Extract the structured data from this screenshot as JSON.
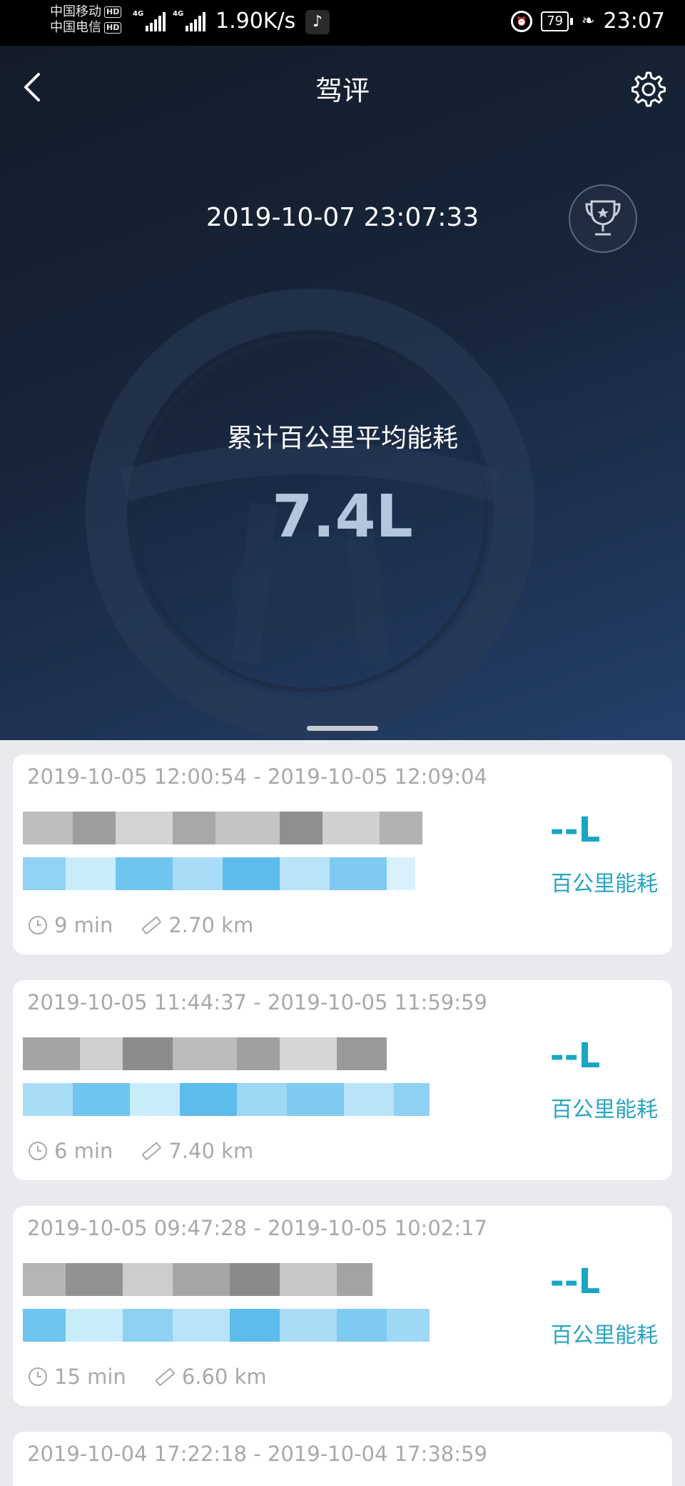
{
  "status_bar": {
    "carrier_1": "中国移动",
    "carrier_2": "中国电信",
    "hd_badge": "HD",
    "network_1": "4G",
    "network_2": "4G",
    "net_speed": "1.90K/s",
    "battery": "79",
    "time": "23:07"
  },
  "header": {
    "title": "驾评"
  },
  "summary": {
    "datetime": "2019-10-07 23:07:33",
    "avg_label": "累计百公里平均能耗",
    "avg_value": "7.4L"
  },
  "trips": [
    {
      "range": "2019-10-05 12:00:54 - 2019-10-05 12:09:04",
      "fuel": "--L",
      "fuel_label": "百公里能耗",
      "duration": "9 min",
      "distance": "2.70 km"
    },
    {
      "range": "2019-10-05 11:44:37 - 2019-10-05 11:59:59",
      "fuel": "--L",
      "fuel_label": "百公里能耗",
      "duration": "6 min",
      "distance": "7.40 km"
    },
    {
      "range": "2019-10-05 09:47:28 - 2019-10-05 10:02:17",
      "fuel": "--L",
      "fuel_label": "百公里能耗",
      "duration": "15 min",
      "distance": "6.60 km"
    },
    {
      "range": "2019-10-04 17:22:18 - 2019-10-04 17:38:59"
    }
  ],
  "colors": {
    "accent": "#1aa5c4",
    "hero_dark": "#141c29",
    "hero_light": "#24406a",
    "muted_text": "#a9a9ad"
  },
  "icons": {
    "back": "chevron-left-icon",
    "settings": "gear-icon",
    "trophy": "trophy-icon",
    "duration": "clock-icon",
    "distance": "ruler-icon"
  }
}
